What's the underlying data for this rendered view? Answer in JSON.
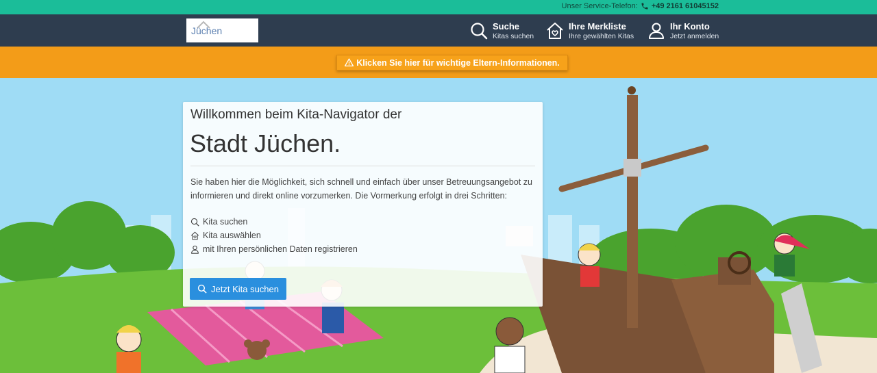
{
  "topbar": {
    "service_label": "Unser Service-Telefon:",
    "phone": "+49 2161 61045152"
  },
  "header": {
    "logo_text": "Jüchen",
    "nav": [
      {
        "title": "Suche",
        "subtitle": "Kitas suchen",
        "icon": "search-icon"
      },
      {
        "title": "Ihre Merkliste",
        "subtitle": "Ihre gewählten Kitas",
        "icon": "house-heart-icon"
      },
      {
        "title": "Ihr Konto",
        "subtitle": "Jetzt anmelden",
        "icon": "user-icon"
      }
    ]
  },
  "infobar": {
    "label": "Klicken Sie hier für wichtige Eltern-Informationen.",
    "icon": "warning-icon"
  },
  "welcome": {
    "line1": "Willkommen beim Kita-Navigator der",
    "line2": "Stadt Jüchen.",
    "intro": "Sie haben hier die Möglichkeit, sich schnell und einfach über unser Betreuungsangebot zu informieren und direkt online vorzumerken. Die Vormerkung erfolgt in drei Schritten:",
    "steps": [
      {
        "label": "Kita suchen",
        "icon": "search-icon"
      },
      {
        "label": "Kita auswählen",
        "icon": "house-heart-icon"
      },
      {
        "label": "mit Ihren persönlichen Daten registrieren",
        "icon": "user-icon"
      }
    ],
    "cta_label": "Jetzt Kita suchen"
  },
  "colors": {
    "topbar": "#1bbd99",
    "header": "#2e3d4f",
    "infobar": "#f39c18",
    "cta": "#2a8fde",
    "sky": "#9fdcf5",
    "grass": "#6cbf3a"
  }
}
